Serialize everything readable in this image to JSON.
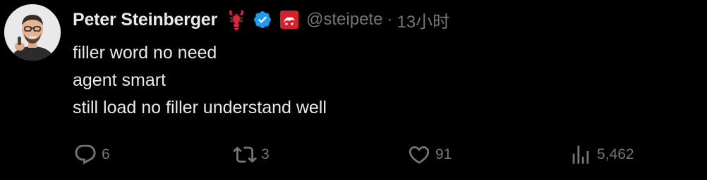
{
  "author": {
    "name": "Peter Steinberger",
    "handle": "@steipete",
    "separator": "·",
    "time": "13小时"
  },
  "badges": {
    "emoji_icon": "lobster-icon",
    "verified_icon": "verified-check-icon",
    "affiliate_icon": "affiliate-logo-icon",
    "verified_color": "#1d9bf0",
    "affiliate_color": "#d6212c"
  },
  "tweet": {
    "lines": [
      "filler word no need",
      "agent smart",
      "still load no filler understand well"
    ]
  },
  "actions": {
    "reply": {
      "icon": "reply-icon",
      "count": "6"
    },
    "retweet": {
      "icon": "retweet-icon",
      "count": "3"
    },
    "like": {
      "icon": "heart-icon",
      "count": "91"
    },
    "views": {
      "icon": "views-icon",
      "count": "5,462"
    }
  },
  "colors": {
    "background": "#000000",
    "text": "#e7e9ea",
    "muted": "#71767b"
  }
}
